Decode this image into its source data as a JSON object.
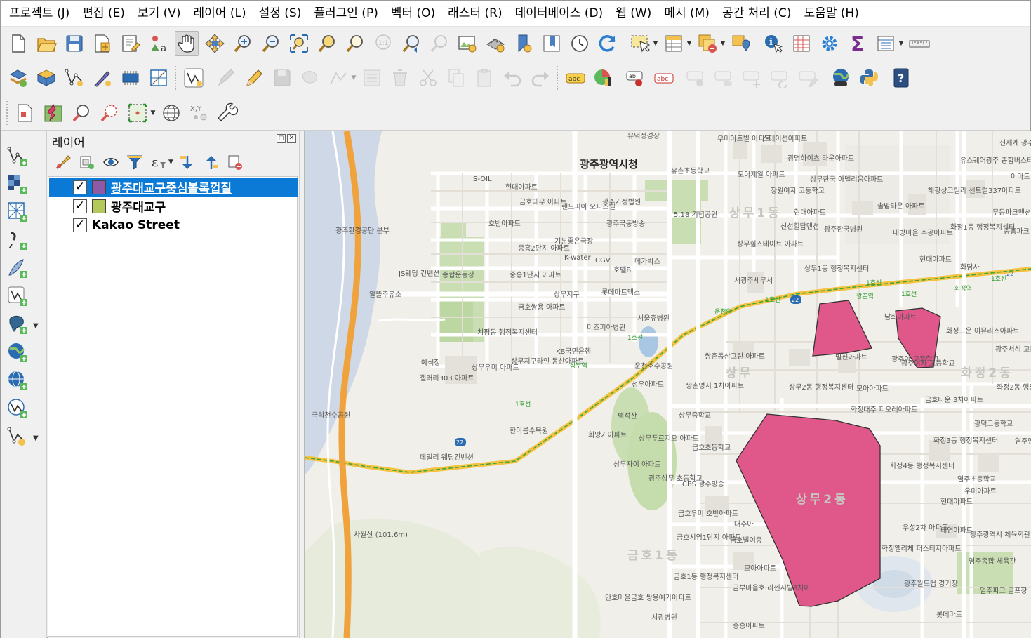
{
  "menu": [
    "프로젝트 (J)",
    "편집 (E)",
    "보기 (V)",
    "레이어 (L)",
    "설정 (S)",
    "플러그인 (P)",
    "벡터 (O)",
    "래스터 (R)",
    "데이터베이스 (D)",
    "웹 (W)",
    "메시 (M)",
    "공간 처리 (C)",
    "도움말 (H)"
  ],
  "layers_panel": {
    "title": "레이어",
    "layers": [
      {
        "name": "광주대교구중심볼록껍질",
        "checked": "✓",
        "color": "#8e5aa8",
        "selected": true
      },
      {
        "name": "광주대교구",
        "checked": "✓",
        "color": "#b4c95c",
        "selected": false
      },
      {
        "name": "Kakao Street",
        "checked": "✓",
        "color": null,
        "selected": false
      }
    ]
  },
  "toolbar_icons": {
    "row1": [
      "new-project",
      "open-project",
      "save-project",
      "save-as",
      "print-layout",
      "style-manager",
      "pan",
      "pan-to-selection",
      "zoom-in",
      "zoom-out",
      "zoom-full",
      "zoom-to-selection",
      "zoom-to-layer",
      "zoom-native",
      "zoom-last",
      "zoom-next",
      "new-map-view",
      "new-3d-view",
      "new-bookmark",
      "show-bookmarks",
      "temporal-controller",
      "refresh",
      "select-features",
      "open-attribute-table",
      "deselect",
      "select-by-location",
      "identify",
      "attribute-table",
      "settings",
      "statistics",
      "field-calculator",
      "measure"
    ],
    "row2": [
      "data-source-manager",
      "new-geopackage",
      "digitize-vertex",
      "new-shapefile",
      "new-memory-layer",
      "virtual-layer",
      "vector-layer",
      "current-edits",
      "toggle-editing",
      "save-edits",
      "add-feature",
      "vertex-tool",
      "modify-attributes",
      "delete-selected",
      "cut-features",
      "copy-features",
      "paste-features",
      "undo",
      "redo",
      "label-toolbar",
      "diagram",
      "pin-labels",
      "label-highlight",
      "label-show-hide",
      "label-move",
      "label-rotate",
      "label-change",
      "label-properties",
      "python-console",
      "help"
    ],
    "row3": [
      "georeferencer",
      "quickmapservices",
      "zoom-tool",
      "identify-tool",
      "zoom-to-selection-tool",
      "globe",
      "coordinate-capture",
      "processing-toolbox"
    ]
  },
  "map": {
    "title_labels": [
      "광주광역시청"
    ],
    "area_labels": [
      "상무1동",
      "금호1동",
      "상무2동",
      "화정2동",
      "상무"
    ],
    "labels": [
      "유덕정경장",
      "우미아트빌 아파트",
      "스테이션아파트",
      "S-OIL",
      "현대아파트",
      "금호대우 아파트",
      "랜드피아 오피스텔",
      "광주가정법원",
      "5.18 기념공원",
      "광주극동방송",
      "광주환경공단 본부",
      "호반아파트",
      "기분좋은극장",
      "중흥2단지 아파트",
      "K-water",
      "CGV",
      "메가박스",
      "호텔B",
      "종합운동장",
      "중흥1단지 아파트",
      "JS웨딩 컨벤션",
      "알뜰주유소",
      "롯데마트맥스",
      "상무지구",
      "금호쌍용 아파트",
      "치평동 행정복지센터",
      "미즈피아병원",
      "서울휴병원",
      "KB국민은행",
      "운천호수공원",
      "상무지구라인 동산아파트",
      "예식장",
      "갤러리303 아파트",
      "상무우미 아파트",
      "성우아파트",
      "쌍촌동삼그린 아파트",
      "쌍촌명지 1차아파트",
      "상무중학교",
      "백석산",
      "한아름수목원",
      "극락천수공원",
      "데일리 웨딩컨벤션",
      "희망가아파트",
      "상무푸르지오 아파트",
      "상무자이 아파트",
      "광주상무 초등학교",
      "CBS 광주방송",
      "금호초등학교",
      "금호우미 호반아파트",
      "금호시영1단지 아파트",
      "금호빌여중",
      "금호1동 행정복지센터",
      "만호마을금호 쌍용예가아파트",
      "서광병원",
      "사월산 (101.6m)",
      "중흥아파트",
      "유촌초등학교",
      "모아제일 아파트",
      "광명하이츠 타운아파트",
      "장원여자 고등학교",
      "상무한국 아델리움아파트",
      "현대아파트",
      "신선힐탑맨션",
      "광주한국병원",
      "상무힐스테이트 아파트",
      "서광주세무서",
      "상무1동 행정복지센터",
      "솔밭타운 아파트",
      "내방마을 주공아파트",
      "현대아파트",
      "화정1동 행정복지센터",
      "화담사",
      "해광상그릴라 센트럴337아파트",
      "유스퀘어광주 종합버스터미널",
      "무등파크맨션",
      "중흥파크 아파트",
      "남화아파트",
      "빌신아파트",
      "광주여자 고등학교",
      "화정고운 이뮤리스아파트",
      "상무2동 행정복지센터",
      "모아아파트",
      "화정대주 피오레아파트",
      "금호타운 3차아파트",
      "화정3동 행정복지센터",
      "광덕고등학교",
      "염주맨션",
      "화정4동 행정복지센터",
      "염주초등학교",
      "우미아파트",
      "현대아파트",
      "우성2차 아파트",
      "태영아파트",
      "화정엘리체 퍼스티지아파트",
      "광주월드컵 경기장",
      "염주종합 체육관",
      "염주파크 골프장",
      "롯데마트",
      "광주광역시 체육회관",
      "광주서석 고등학교",
      "화정2동 행정복지",
      "신세계 광주신",
      "이마트",
      "상무역",
      "운천역",
      "쌍촌역",
      "화정역",
      "광주여 고등학교",
      "대주아",
      "모아아파트",
      "금부마을호 리젠시빌3차아"
    ],
    "road_labels": [
      "1호선",
      "1호선",
      "1호선",
      "1호선",
      "1호선",
      "1호선"
    ],
    "road_numbers": [
      "22",
      "22",
      "22"
    ]
  }
}
